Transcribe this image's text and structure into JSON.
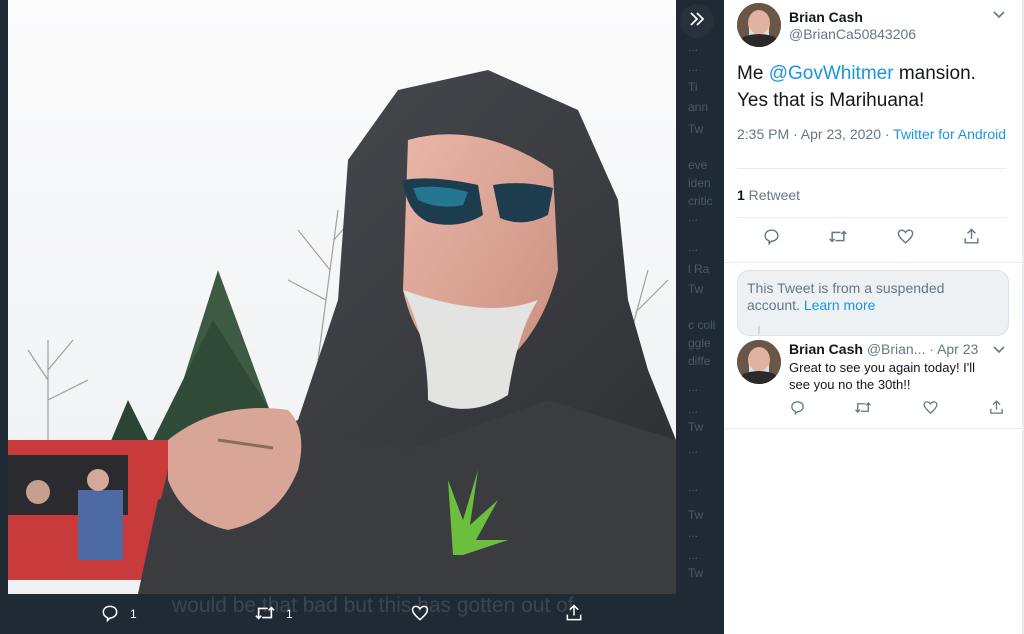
{
  "media_actions": {
    "reply_count": "1",
    "retweet_count": "1"
  },
  "background_text": {
    "caption_line": "would be that bad but this has gotten out of",
    "ghost_fragments": [
      "...",
      "Ti",
      "ann",
      "Tw",
      "eve",
      "iden",
      "critic",
      "...",
      "l Ra",
      "Tw",
      "c coll",
      "ggle",
      "diffe",
      "...",
      "...",
      "...",
      "Tw",
      "...",
      "...",
      "Tw",
      "...",
      "...",
      "...",
      "...",
      "Tw"
    ]
  },
  "tweet": {
    "name": "Brian Cash",
    "handle": "@BrianCa50843206",
    "text_before": "Me ",
    "mention": "@GovWhitmer",
    "text_after": " mansion. Yes that is Marihuana!",
    "time": "2:35 PM · Apr 23, 2020 · ",
    "source": "Twitter for Android",
    "retweets_num": "1",
    "retweets_label": " Retweet"
  },
  "notice": {
    "text": "This Tweet is from a suspended account. ",
    "link": "Learn more"
  },
  "reply": {
    "name": "Brian Cash",
    "handle": "@Brian...",
    "dot": " · ",
    "date": "Apr 23",
    "text": "Great to see you again today! I'll see you no the 30th!!"
  },
  "icons": [
    "expand-right-icon",
    "reply-icon",
    "retweet-icon",
    "like-icon",
    "share-icon",
    "chevron-down-icon"
  ]
}
